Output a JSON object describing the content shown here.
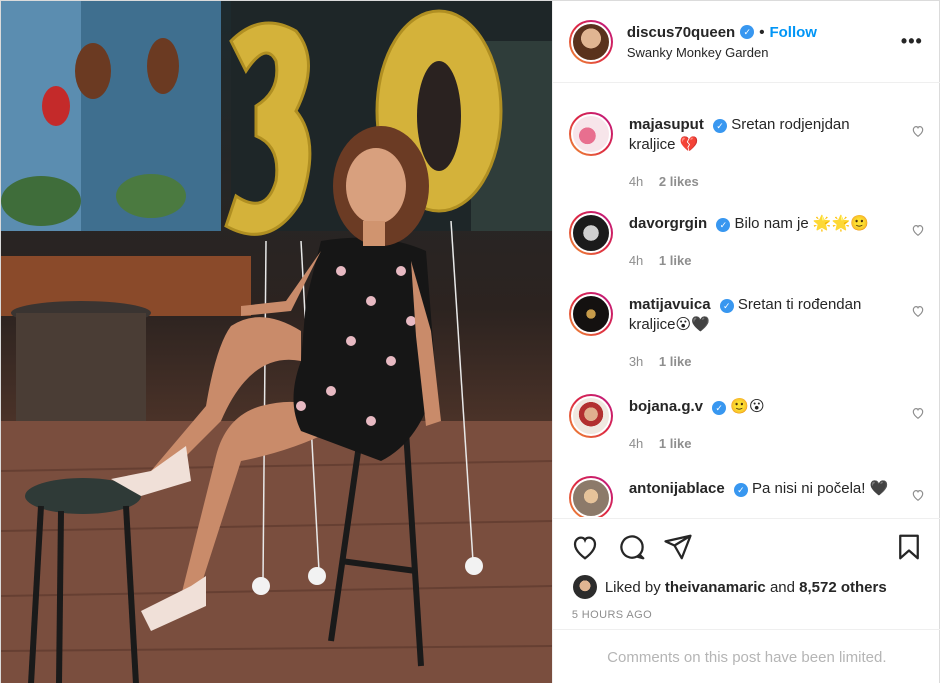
{
  "post": {
    "username": "discus70queen",
    "follow_label": "Follow",
    "location": "Swanky Monkey Garden",
    "more_label": "•••"
  },
  "comments": [
    {
      "user": "majasuput",
      "text": "Sretan rodjenjdan kraljice 💔",
      "time": "4h",
      "likes": "2 likes"
    },
    {
      "user": "davorgrgin",
      "text": "Bilo nam je 🌟🌟🙂",
      "time": "4h",
      "likes": "1 like"
    },
    {
      "user": "matijavuica",
      "text": "Sretan ti rođendan kraljice😮🖤",
      "time": "3h",
      "likes": "1 like"
    },
    {
      "user": "bojana.g.v",
      "text": "🙂😮",
      "time": "4h",
      "likes": "1 like"
    },
    {
      "user": "antonijablace",
      "text": "Pa nisi ni počela! 🖤",
      "time": "",
      "likes": ""
    }
  ],
  "likes_summary": {
    "prefix": "Liked by ",
    "user": "theivanamaric",
    "middle": " and ",
    "others": "8,572 others"
  },
  "timestamp": "5 HOURS AGO",
  "limited_notice": "Comments on this post have been limited.",
  "icons": [
    "verified-badge-icon",
    "heart-icon",
    "comment-icon",
    "share-icon",
    "save-icon",
    "more-icon"
  ],
  "colors": {
    "link": "#0095f6",
    "verified": "#3897f0",
    "muted": "#8e8e8e",
    "balloon": "#d4b23a"
  }
}
